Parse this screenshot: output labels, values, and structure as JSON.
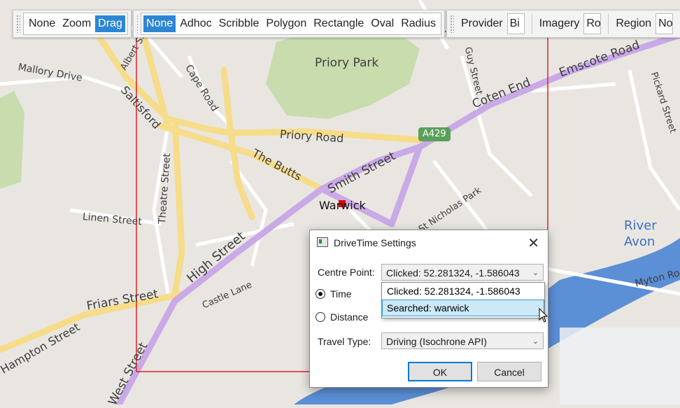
{
  "toolbar": {
    "mode_buttons": [
      "None",
      "Zoom",
      "Drag"
    ],
    "mode_active": "Drag",
    "draw_buttons": [
      "None",
      "Adhoc",
      "Scribble",
      "Polygon",
      "Rectangle",
      "Oval",
      "Radius"
    ],
    "draw_active": "None",
    "provider_label": "Provider",
    "provider_value": "Bi",
    "imagery_label": "Imagery",
    "imagery_value": "Ro",
    "region_label": "Region",
    "region_value": "No"
  },
  "map_labels": {
    "priory_park": "Priory Park",
    "priory_road": "Priory Road",
    "the_butts": "The Butts",
    "smith_street": "Smith Street",
    "warwick": "Warwick",
    "high_street": "High Street",
    "coten_end": "Coten End",
    "emscote_road": "Emscote Road",
    "saltisford": "Saltisford",
    "mallory_drive": "Mallory Drive",
    "albert_street": "Albert Street",
    "cape_road": "Cape Road",
    "theatre_street": "Theatre Street",
    "linen_street": "Linen Street",
    "castle_lane": "Castle Lane",
    "friars_street": "Friars Street",
    "hampton_street": "Hampton Street",
    "west_street": "West Street",
    "guy_street": "Guy Street",
    "pickard_street": "Pickard Street",
    "st_nicholas_park": "St Nicholas Park",
    "river_avon_1": "River",
    "river_avon_2": "Avon",
    "myton_road": "Myton Ro",
    "a429": "A429"
  },
  "dialog": {
    "title": "DriveTime Settings",
    "close_glyph": "✕",
    "centre_point_label": "Centre Point:",
    "centre_point_value": "Clicked: 52.281324, -1.586043",
    "time_label": "Time",
    "distance_label": "Distance",
    "time_checked": true,
    "travel_type_label": "Travel Type:",
    "travel_type_value": "Driving (Isochrone API)",
    "ok_label": "OK",
    "cancel_label": "Cancel"
  },
  "dropdown": {
    "options": [
      "Clicked: 52.281324, -1.586043",
      "Searched: warwick"
    ],
    "hovered_index": 1
  },
  "colors": {
    "accent": "#2d86d4",
    "main_road": "#f7dc8a",
    "route": "#c9a9e6",
    "park": "#c8dcae",
    "river": "#5b8fd6",
    "selection": "#e0202a"
  }
}
